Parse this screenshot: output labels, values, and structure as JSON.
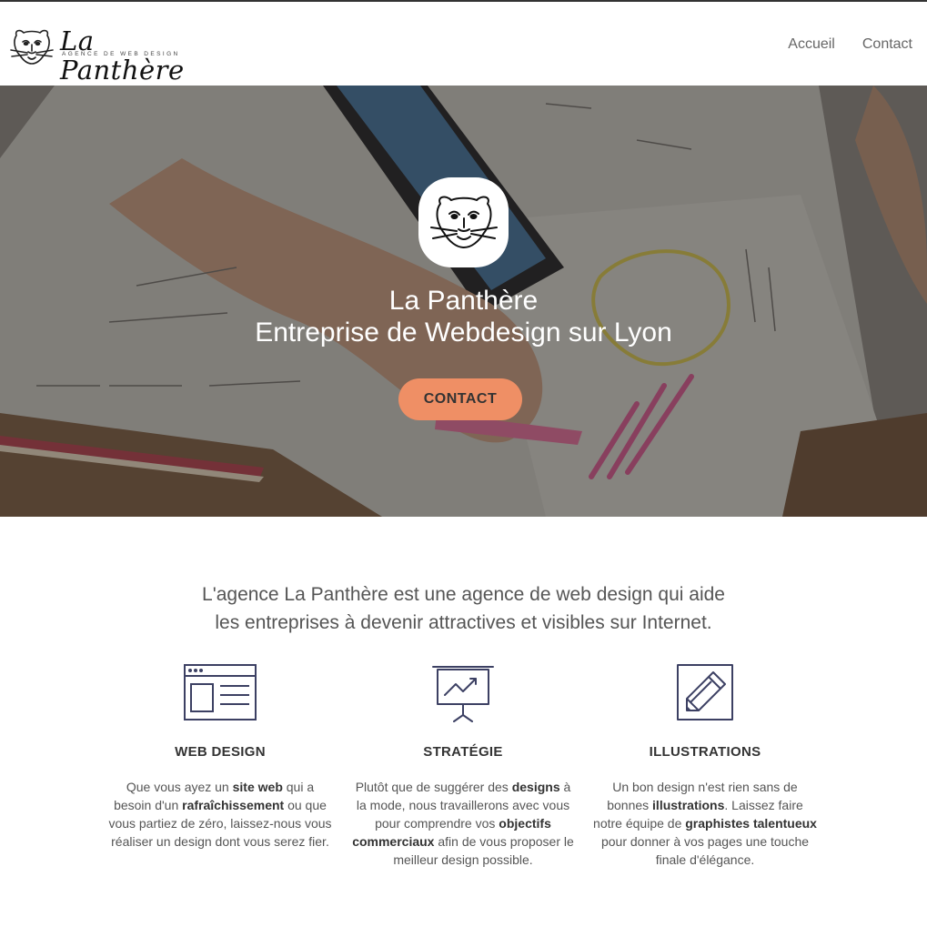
{
  "header": {
    "logo_text": "La Panthère",
    "logo_tagline": "AGENCE DE WEB DESIGN",
    "nav": [
      {
        "label": "Accueil"
      },
      {
        "label": "Contact"
      }
    ]
  },
  "hero": {
    "title_line1": "La Panthère",
    "title_line2": "Entreprise de Webdesign sur Lyon",
    "button_label": "CONTACT",
    "button_color": "#ef8f65"
  },
  "intro": {
    "line1": "L'agence La Panthère est une agence de web design qui aide",
    "line2": "les entreprises à devenir attractives et visibles sur Internet."
  },
  "features": [
    {
      "icon": "browser-window-icon",
      "title": "WEB DESIGN",
      "text": [
        {
          "t": "Que vous ayez un ",
          "b": false
        },
        {
          "t": "site web",
          "b": true
        },
        {
          "t": " qui a besoin d'un ",
          "b": false
        },
        {
          "t": "rafraîchissement",
          "b": true
        },
        {
          "t": " ou que vous partiez de zéro, laissez-nous vous réaliser un design dont vous serez fier.",
          "b": false
        }
      ]
    },
    {
      "icon": "presentation-chart-icon",
      "title": "STRATÉGIE",
      "text": [
        {
          "t": "Plutôt que de suggérer des ",
          "b": false
        },
        {
          "t": "designs",
          "b": true
        },
        {
          "t": " à la mode, nous travaillerons avec vous pour comprendre vos ",
          "b": false
        },
        {
          "t": "objectifs commerciaux",
          "b": true
        },
        {
          "t": " afin de vous proposer le meilleur design possible.",
          "b": false
        }
      ]
    },
    {
      "icon": "pencil-edit-icon",
      "title": "ILLUSTRATIONS",
      "text": [
        {
          "t": "Un bon design n'est rien sans de bonnes ",
          "b": false
        },
        {
          "t": "illustrations",
          "b": true
        },
        {
          "t": ". Laissez faire notre équipe de ",
          "b": false
        },
        {
          "t": "graphistes talentueux",
          "b": true
        },
        {
          "t": " pour donner à vos pages une touche finale d'élégance.",
          "b": false
        }
      ]
    }
  ],
  "colors": {
    "icon_stroke": "#3c4063",
    "accent": "#ef8f65"
  }
}
